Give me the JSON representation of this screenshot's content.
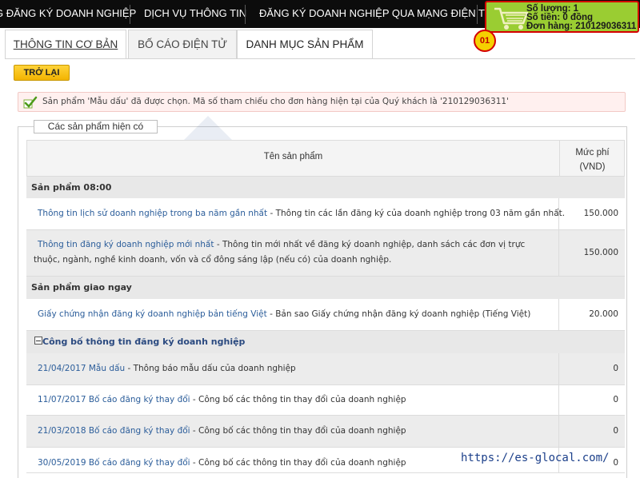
{
  "topnav": {
    "items": [
      "G ĐĂNG KÝ DOANH NGHIỆP",
      "DỊCH VỤ THÔNG TIN",
      "ĐĂNG KÝ DOANH NGHIỆP QUA MẠNG ĐIỆN TỬ"
    ]
  },
  "cart": {
    "icon": "shopping-cart-icon",
    "quantity": "Số lượng: 1",
    "amount": "Số tiền: 0 đồng",
    "order": "Đơn hàng: 210129036311",
    "colors": {
      "background": "#9acd32",
      "border": "#d40000"
    }
  },
  "badge": "01",
  "tabs": [
    "THÔNG TIN CƠ BẢN",
    "BỐ CÁO ĐIỆN TỬ",
    "DANH MỤC SẢN PHẨM"
  ],
  "back_button": "TRỞ LẠI",
  "notice": {
    "icon": "check-icon",
    "text": "Sản phẩm 'Mẫu dấu' đã được chọn. Mã số tham chiếu cho đơn hàng hiện tại của Quý khách là '210129036311'"
  },
  "products_box": {
    "legend": "Các sản phẩm hiện có",
    "header": {
      "name": "Tên sản phẩm",
      "fee_line1": "Mức phí",
      "fee_line2": "(VND)"
    },
    "groups": {
      "g1": "Sản phẩm 08:00",
      "g2": "Sản phẩm giao ngay",
      "g3": "Công bố thông tin đăng ký doanh nghiệp"
    },
    "rows": [
      {
        "link": "Thông tin lịch sử doanh nghiệp trong ba năm gần nhất",
        "desc": " - Thông tin các lần đăng ký của doanh nghiệp trong 03 năm gần nhất.",
        "fee": "150.000"
      },
      {
        "link": "Thông tin đăng ký doanh nghiệp mới nhất",
        "desc": " - Thông tin mới nhất về đăng ký doanh nghiệp, danh sách các đơn vị trực thuộc, ngành, nghề kinh doanh, vốn và cổ đông sáng lập (nếu có) của doanh nghiệp.",
        "fee": "150.000"
      },
      {
        "link": "Giấy chứng nhận đăng ký doanh nghiệp bản tiếng Việt",
        "desc": " - Bản sao Giấy chứng nhận đăng ký doanh nghiệp (Tiếng Việt)",
        "fee": "20.000"
      },
      {
        "link": "21/04/2017 Mẫu dấu",
        "desc": " - Thông báo mẫu dấu của doanh nghiệp",
        "fee": "0"
      },
      {
        "link": "11/07/2017 Bố cáo đăng ký thay đổi",
        "desc": " - Công bố các thông tin thay đổi của doanh nghiệp",
        "fee": "0"
      },
      {
        "link": "21/03/2018 Bố cáo đăng ký thay đổi",
        "desc": " - Công bố các thông tin thay đổi của doanh nghiệp",
        "fee": "0"
      },
      {
        "link": "30/05/2019 Bố cáo đăng ký thay đổi",
        "desc": " - Công bố các thông tin thay đổi của doanh nghiệp",
        "fee": "0"
      }
    ]
  },
  "watermark_url": "https://es-glocal.com/",
  "colors": {
    "link": "#2b5d9a",
    "accent_yellow": "#f3b400",
    "notice_bg": "#fff0ef"
  }
}
